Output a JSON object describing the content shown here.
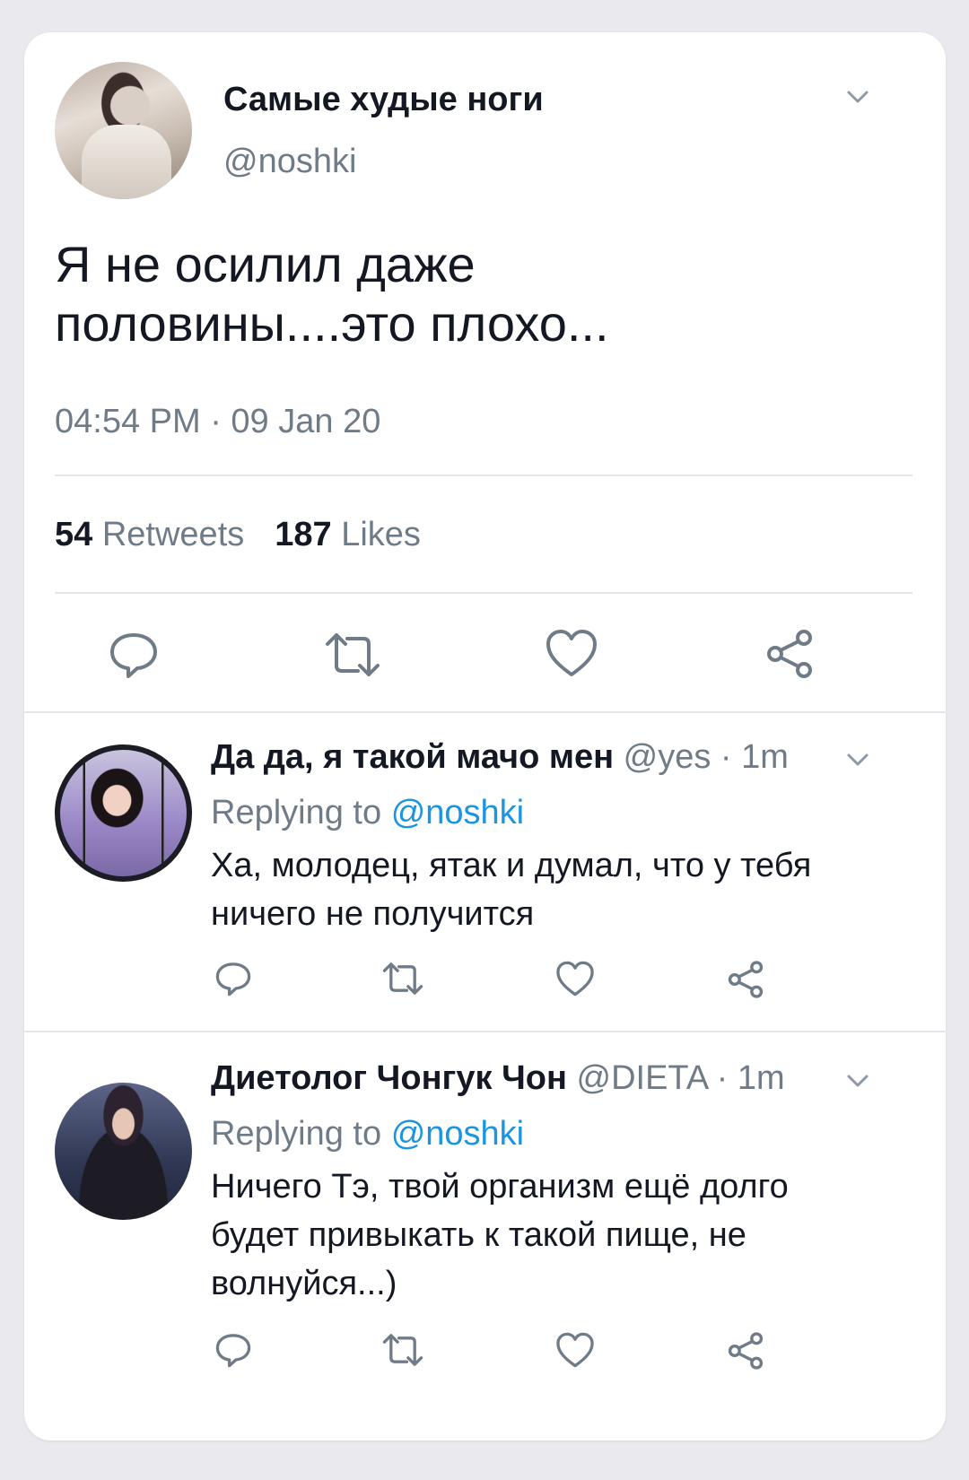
{
  "main_tweet": {
    "name": "Самые худые ноги",
    "handle": "@noshki",
    "text_line1": "Я не осилил даже",
    "text_line2": "половины....это плохо...",
    "timestamp": "04:54 PM · 09 Jan 20",
    "retweets_count": "54",
    "retweets_label": "Retweets",
    "likes_count": "187",
    "likes_label": "Likes"
  },
  "replies": [
    {
      "name": "Да да, я такой мачо мен",
      "meta": "@yes · 1m",
      "replying_prefix": "Replying to",
      "replying_to": "@noshki",
      "text_line1": "Ха, молодец, ятак и думал, что у тебя",
      "text_line2": "ничего не получится"
    },
    {
      "name": "Диетолог Чонгук Чон",
      "meta": "@DIETA · 1m",
      "replying_prefix": "Replying to",
      "replying_to": "@noshki",
      "text_line1": "Ничего Тэ, твой организм ещё долго",
      "text_line2": "будет привыкать к такой пище, не",
      "text_line3": "волнуйся...)"
    }
  ],
  "icons": {
    "reply": "reply-icon",
    "retweet": "retweet-icon",
    "like": "heart-icon",
    "share": "share-icon",
    "more": "chevron-down-icon"
  },
  "colors": {
    "background": "#e9e9ee",
    "card": "#ffffff",
    "text_primary": "#141823",
    "text_secondary": "#707b88",
    "link": "#1b95e0",
    "divider": "#e1e6ea",
    "icon": "#707b88"
  }
}
